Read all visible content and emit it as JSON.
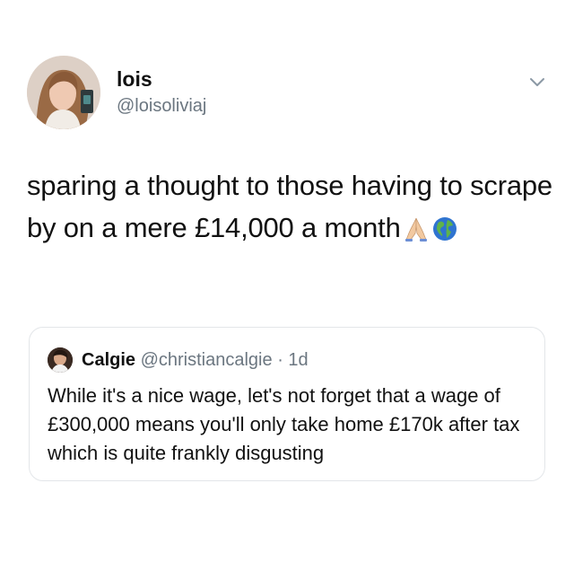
{
  "author": {
    "display_name": "lois",
    "handle": "@loisoliviaj"
  },
  "tweet": {
    "text": "sparing a thought to those having to scrape by on a mere £14,000 a month",
    "emojis": [
      "folded-hands-emoji",
      "globe-emoji"
    ]
  },
  "menu": {
    "icon": "chevron-down-icon"
  },
  "quoted_tweet": {
    "display_name": "Calgie",
    "handle": "@christiancalgie",
    "separator": "·",
    "time": "1d",
    "text": "While it's a nice wage, let's not forget that a wage of £300,000 means you'll only take home £170k after tax which is quite frankly disgusting"
  }
}
